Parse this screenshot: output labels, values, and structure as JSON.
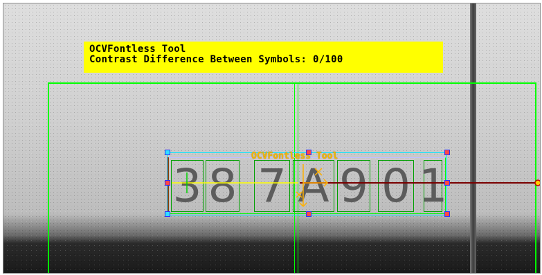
{
  "banner": {
    "line1": "OCVFontless Tool",
    "line2": "Contrast Difference Between Symbols: 0/100",
    "color": "#ffff00"
  },
  "tool": {
    "label": "OCVFontless Tool",
    "label_color": "#f5b800"
  },
  "symbols": [
    "3",
    "8",
    "7",
    "A",
    "9",
    "0",
    "1"
  ],
  "colors": {
    "roi": "#00ff00",
    "handle": "#ff4848",
    "handle_border": "#3030ff",
    "axis_line": "#7a0000",
    "cursor": "#ffb000"
  },
  "icons": {
    "handles": "square-handle-icon",
    "crosshair": "crosshair-icon",
    "axis_end": "axis-end-marker-icon"
  }
}
